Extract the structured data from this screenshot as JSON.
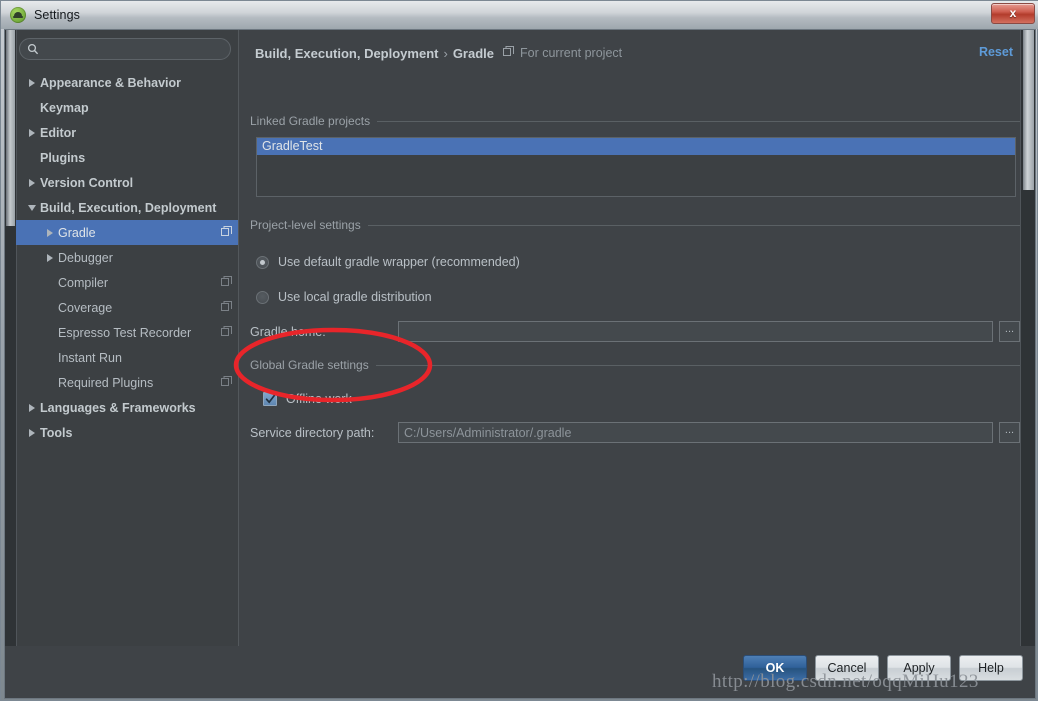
{
  "window": {
    "title": "Settings",
    "app_icon": "android-studio-icon",
    "close_label": "x"
  },
  "sidebar": {
    "search": {
      "placeholder": "",
      "value": "",
      "icon": "search-icon"
    },
    "items": [
      {
        "label": "Appearance & Behavior",
        "twisty": "right",
        "bold": true,
        "indent": 0,
        "icon": null,
        "selected": false
      },
      {
        "label": "Keymap",
        "twisty": "none",
        "bold": true,
        "indent": 0,
        "icon": null,
        "selected": false
      },
      {
        "label": "Editor",
        "twisty": "right",
        "bold": true,
        "indent": 0,
        "icon": null,
        "selected": false
      },
      {
        "label": "Plugins",
        "twisty": "none",
        "bold": true,
        "indent": 0,
        "icon": null,
        "selected": false
      },
      {
        "label": "Version Control",
        "twisty": "right",
        "bold": true,
        "indent": 0,
        "icon": null,
        "selected": false
      },
      {
        "label": "Build, Execution, Deployment",
        "twisty": "down",
        "bold": true,
        "indent": 0,
        "icon": null,
        "selected": false
      },
      {
        "label": "Gradle",
        "twisty": "right",
        "bold": false,
        "indent": 1,
        "icon": "stack-icon",
        "selected": true
      },
      {
        "label": "Debugger",
        "twisty": "right",
        "bold": false,
        "indent": 1,
        "icon": null,
        "selected": false
      },
      {
        "label": "Compiler",
        "twisty": "none",
        "bold": false,
        "indent": 1,
        "icon": "stack-icon",
        "selected": false
      },
      {
        "label": "Coverage",
        "twisty": "none",
        "bold": false,
        "indent": 1,
        "icon": "stack-icon",
        "selected": false
      },
      {
        "label": "Espresso Test Recorder",
        "twisty": "none",
        "bold": false,
        "indent": 1,
        "icon": "stack-icon",
        "selected": false
      },
      {
        "label": "Instant Run",
        "twisty": "none",
        "bold": false,
        "indent": 1,
        "icon": null,
        "selected": false
      },
      {
        "label": "Required Plugins",
        "twisty": "none",
        "bold": false,
        "indent": 1,
        "icon": "stack-icon",
        "selected": false
      },
      {
        "label": "Languages & Frameworks",
        "twisty": "right",
        "bold": true,
        "indent": 0,
        "icon": null,
        "selected": false
      },
      {
        "label": "Tools",
        "twisty": "right",
        "bold": true,
        "indent": 0,
        "icon": null,
        "selected": false
      }
    ]
  },
  "content": {
    "breadcrumb": {
      "parent": "Build, Execution, Deployment",
      "separator": "›",
      "current": "Gradle",
      "scope_icon": "stack-icon",
      "scope": "For current project"
    },
    "reset_label": "Reset",
    "linked_projects": {
      "group_title": "Linked Gradle projects",
      "items": [
        "GradleTest"
      ],
      "selected": "GradleTest"
    },
    "project_level": {
      "group_title": "Project-level settings",
      "radios": [
        {
          "label": "Use default gradle wrapper (recommended)",
          "checked": true
        },
        {
          "label": "Use local gradle distribution",
          "checked": false
        }
      ],
      "gradle_home": {
        "label": "Gradle home:",
        "value": "",
        "placeholder": "",
        "browse_label": "..."
      }
    },
    "global_settings": {
      "group_title": "Global Gradle settings",
      "offline_work": {
        "label": "Offline work",
        "checked": true
      },
      "service_directory": {
        "label": "Service directory path:",
        "value": "C:/Users/Administrator/.gradle",
        "browse_label": "..."
      }
    }
  },
  "buttons": [
    {
      "label": "OK",
      "primary": true
    },
    {
      "label": "Cancel",
      "primary": false
    },
    {
      "label": "Apply",
      "primary": false
    },
    {
      "label": "Help",
      "primary": false
    }
  ],
  "annotation": {
    "shape": "ellipse",
    "color": "#e8252a",
    "target": "Offline work"
  },
  "watermark": "http://blog.csdn.net/oqqMiHu123",
  "colors": {
    "accent_selection": "#4a72b5",
    "link": "#5e9bd8",
    "panel_bg": "#3f4347",
    "sidebar_bg": "#3c4043",
    "annotation_red": "#e8252a"
  }
}
